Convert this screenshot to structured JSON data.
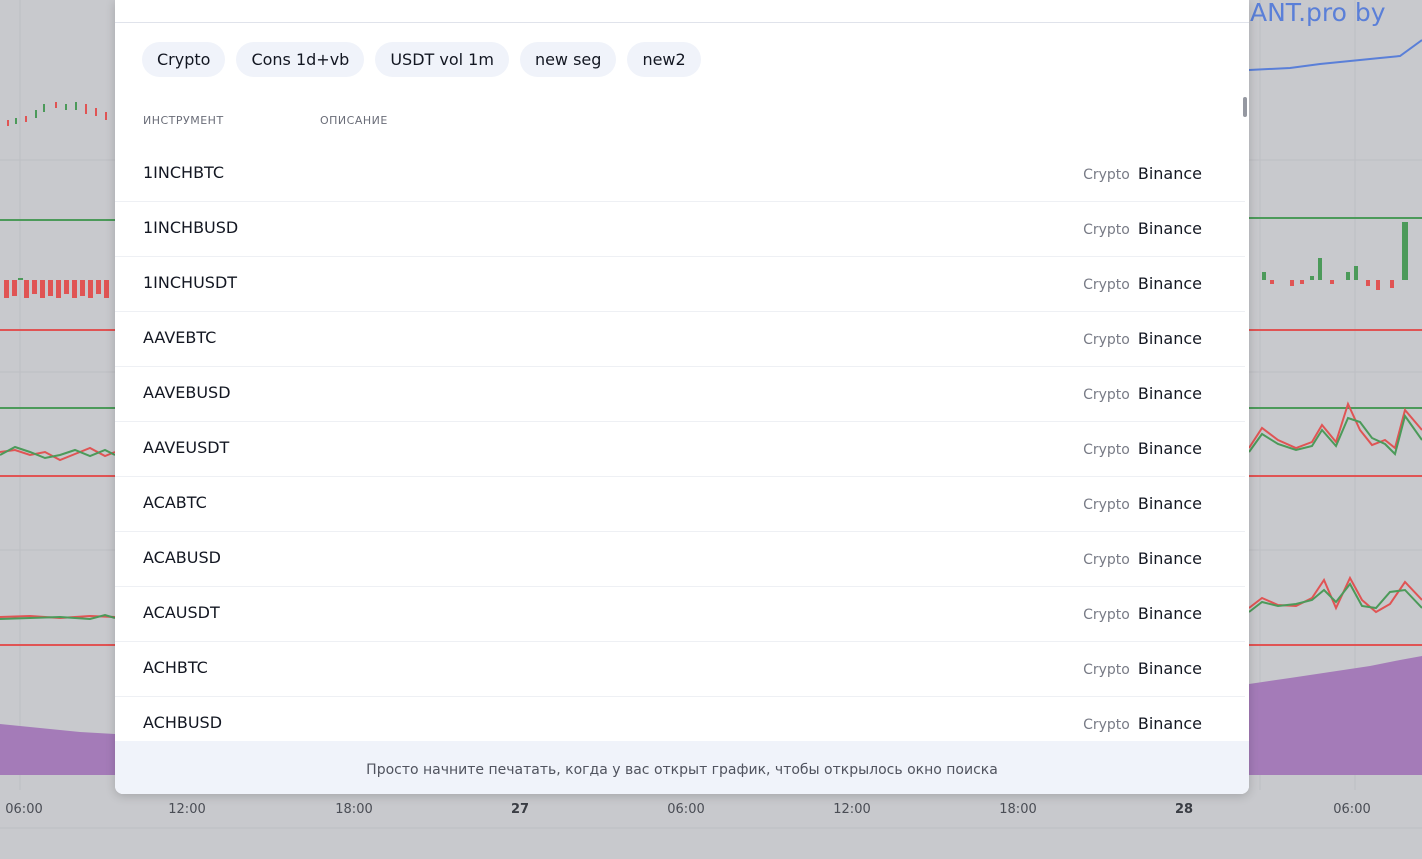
{
  "watermark": "ANT.pro by",
  "time_axis": [
    "06:00",
    "12:00",
    "18:00",
    "27",
    "06:00",
    "12:00",
    "18:00",
    "28",
    "06:00"
  ],
  "chips": [
    "Crypto",
    "Cons 1d+vb",
    "USDT vol 1m",
    "new seg",
    "new2"
  ],
  "columns": {
    "instrument": "ИНСТРУМЕНТ",
    "description": "ОПИСАНИЕ"
  },
  "rows": [
    {
      "symbol": "1INCHBTC",
      "type": "Crypto",
      "exchange": "Binance"
    },
    {
      "symbol": "1INCHBUSD",
      "type": "Crypto",
      "exchange": "Binance"
    },
    {
      "symbol": "1INCHUSDT",
      "type": "Crypto",
      "exchange": "Binance"
    },
    {
      "symbol": "AAVEBTC",
      "type": "Crypto",
      "exchange": "Binance"
    },
    {
      "symbol": "AAVEBUSD",
      "type": "Crypto",
      "exchange": "Binance"
    },
    {
      "symbol": "AAVEUSDT",
      "type": "Crypto",
      "exchange": "Binance"
    },
    {
      "symbol": "ACABTC",
      "type": "Crypto",
      "exchange": "Binance"
    },
    {
      "symbol": "ACABUSD",
      "type": "Crypto",
      "exchange": "Binance"
    },
    {
      "symbol": "ACAUSDT",
      "type": "Crypto",
      "exchange": "Binance"
    },
    {
      "symbol": "ACHBTC",
      "type": "Crypto",
      "exchange": "Binance"
    },
    {
      "symbol": "ACHBUSD",
      "type": "Crypto",
      "exchange": "Binance"
    }
  ],
  "footer_hint": "Просто начните печатать, когда у вас открыт график, чтобы открылось окно поиска",
  "colors": {
    "chip_bg": "#f0f3fa",
    "text": "#131722",
    "muted": "#787b86",
    "red": "#e05454",
    "green": "#4c9a5a",
    "purple": "#a47bb8",
    "blue": "#5a7fd8"
  }
}
